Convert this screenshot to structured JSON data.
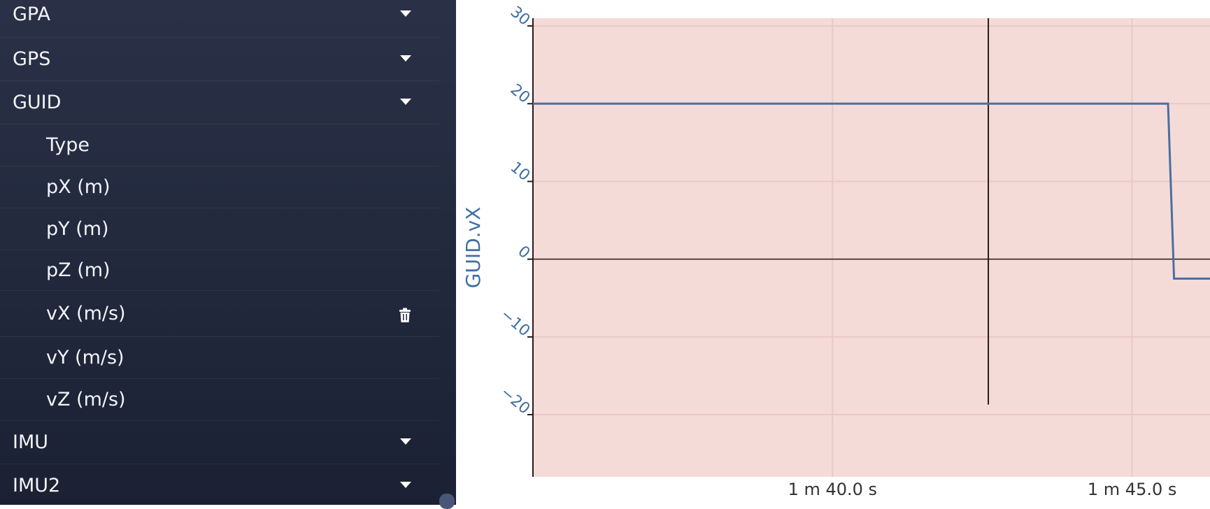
{
  "sidebar": {
    "groups_top": [
      {
        "label": "GPA"
      },
      {
        "label": "GPS"
      },
      {
        "label": "GUID"
      }
    ],
    "guid_children": [
      {
        "label": "Type"
      },
      {
        "label": "pX (m)"
      },
      {
        "label": "pY (m)"
      },
      {
        "label": "pZ (m)"
      },
      {
        "label": "vX (m/s)",
        "selected": true,
        "action_icon": "trash-icon"
      },
      {
        "label": "vY (m/s)"
      },
      {
        "label": "vZ (m/s)"
      }
    ],
    "groups_bottom": [
      {
        "label": "IMU"
      },
      {
        "label": "IMU2"
      }
    ],
    "expand_icon": "caret-down-icon"
  },
  "chart_data": {
    "type": "line",
    "ylabel": "GUID.vX",
    "xlabel": "",
    "ylim": [
      -28,
      31
    ],
    "yticks": [
      {
        "value": 30,
        "label": "30"
      },
      {
        "value": 20,
        "label": "20"
      },
      {
        "value": 10,
        "label": "10"
      },
      {
        "value": 0,
        "label": "0"
      },
      {
        "value": -10,
        "label": "−10"
      },
      {
        "value": -20,
        "label": "−20"
      }
    ],
    "xlim": [
      95,
      48.4
    ],
    "xlim_seconds": [
      95.0,
      106.3
    ],
    "xticks": [
      {
        "value": 100,
        "label": "1 m 40.0 s"
      },
      {
        "value": 105,
        "label": "1 m 45.0 s"
      }
    ],
    "series": [
      {
        "color": "#4a6fa0",
        "x": [
          95.0,
          105.6,
          105.7,
          106.3
        ],
        "y": [
          20,
          20,
          -2.5,
          -2.5
        ]
      }
    ],
    "cursor_x": 102.6,
    "background": "#f5dbd8",
    "grid": true
  }
}
